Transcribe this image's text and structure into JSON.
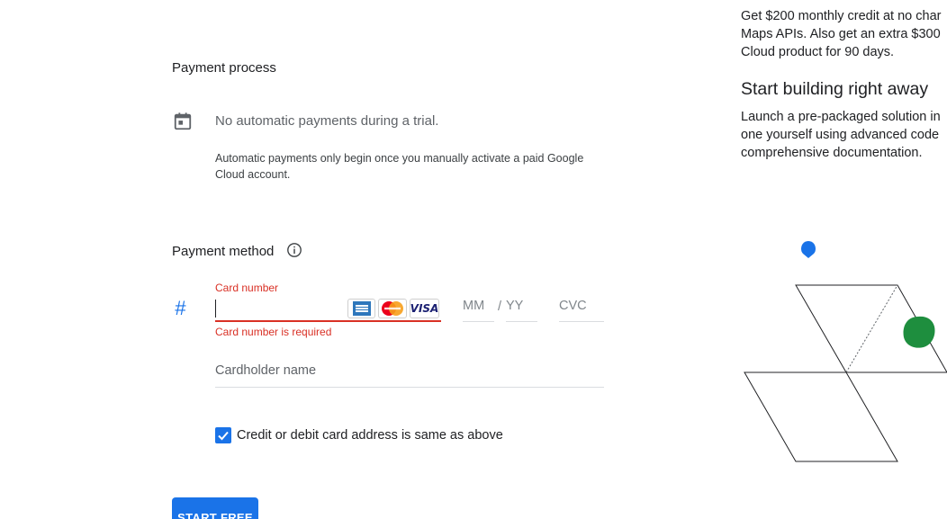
{
  "payment_process": {
    "title": "Payment process",
    "trial_text": "No automatic payments during a trial.",
    "trial_note": "Automatic payments only begin once you manually activate a paid Google Cloud account."
  },
  "payment_method": {
    "title": "Payment method",
    "card_number_label": "Card number",
    "card_number_value": "",
    "card_logos": [
      "amex",
      "mastercard",
      "VISA"
    ],
    "card_error": "Card number is required",
    "mm_placeholder": "MM",
    "slash": "/",
    "yy_placeholder": "YY",
    "cvc_placeholder": "CVC",
    "cardholder_placeholder": "Cardholder name",
    "same_address_label": "Credit or debit card address is same as above",
    "same_address_checked": true
  },
  "actions": {
    "start_free_label": "START FREE"
  },
  "sidebar": {
    "promo_lines": [
      "Get $200 monthly credit at no char",
      "Maps APIs. Also get an extra $300",
      "Cloud product for 90 days."
    ],
    "heading": "Start building right away",
    "body_lines": [
      "Launch a pre-packaged solution in",
      "one yourself using advanced code",
      "comprehensive documentation."
    ]
  },
  "colors": {
    "accent": "#1a73e8",
    "error": "#d93025",
    "illustration_green": "#1e8e3e",
    "illustration_blue": "#1a73e8"
  }
}
